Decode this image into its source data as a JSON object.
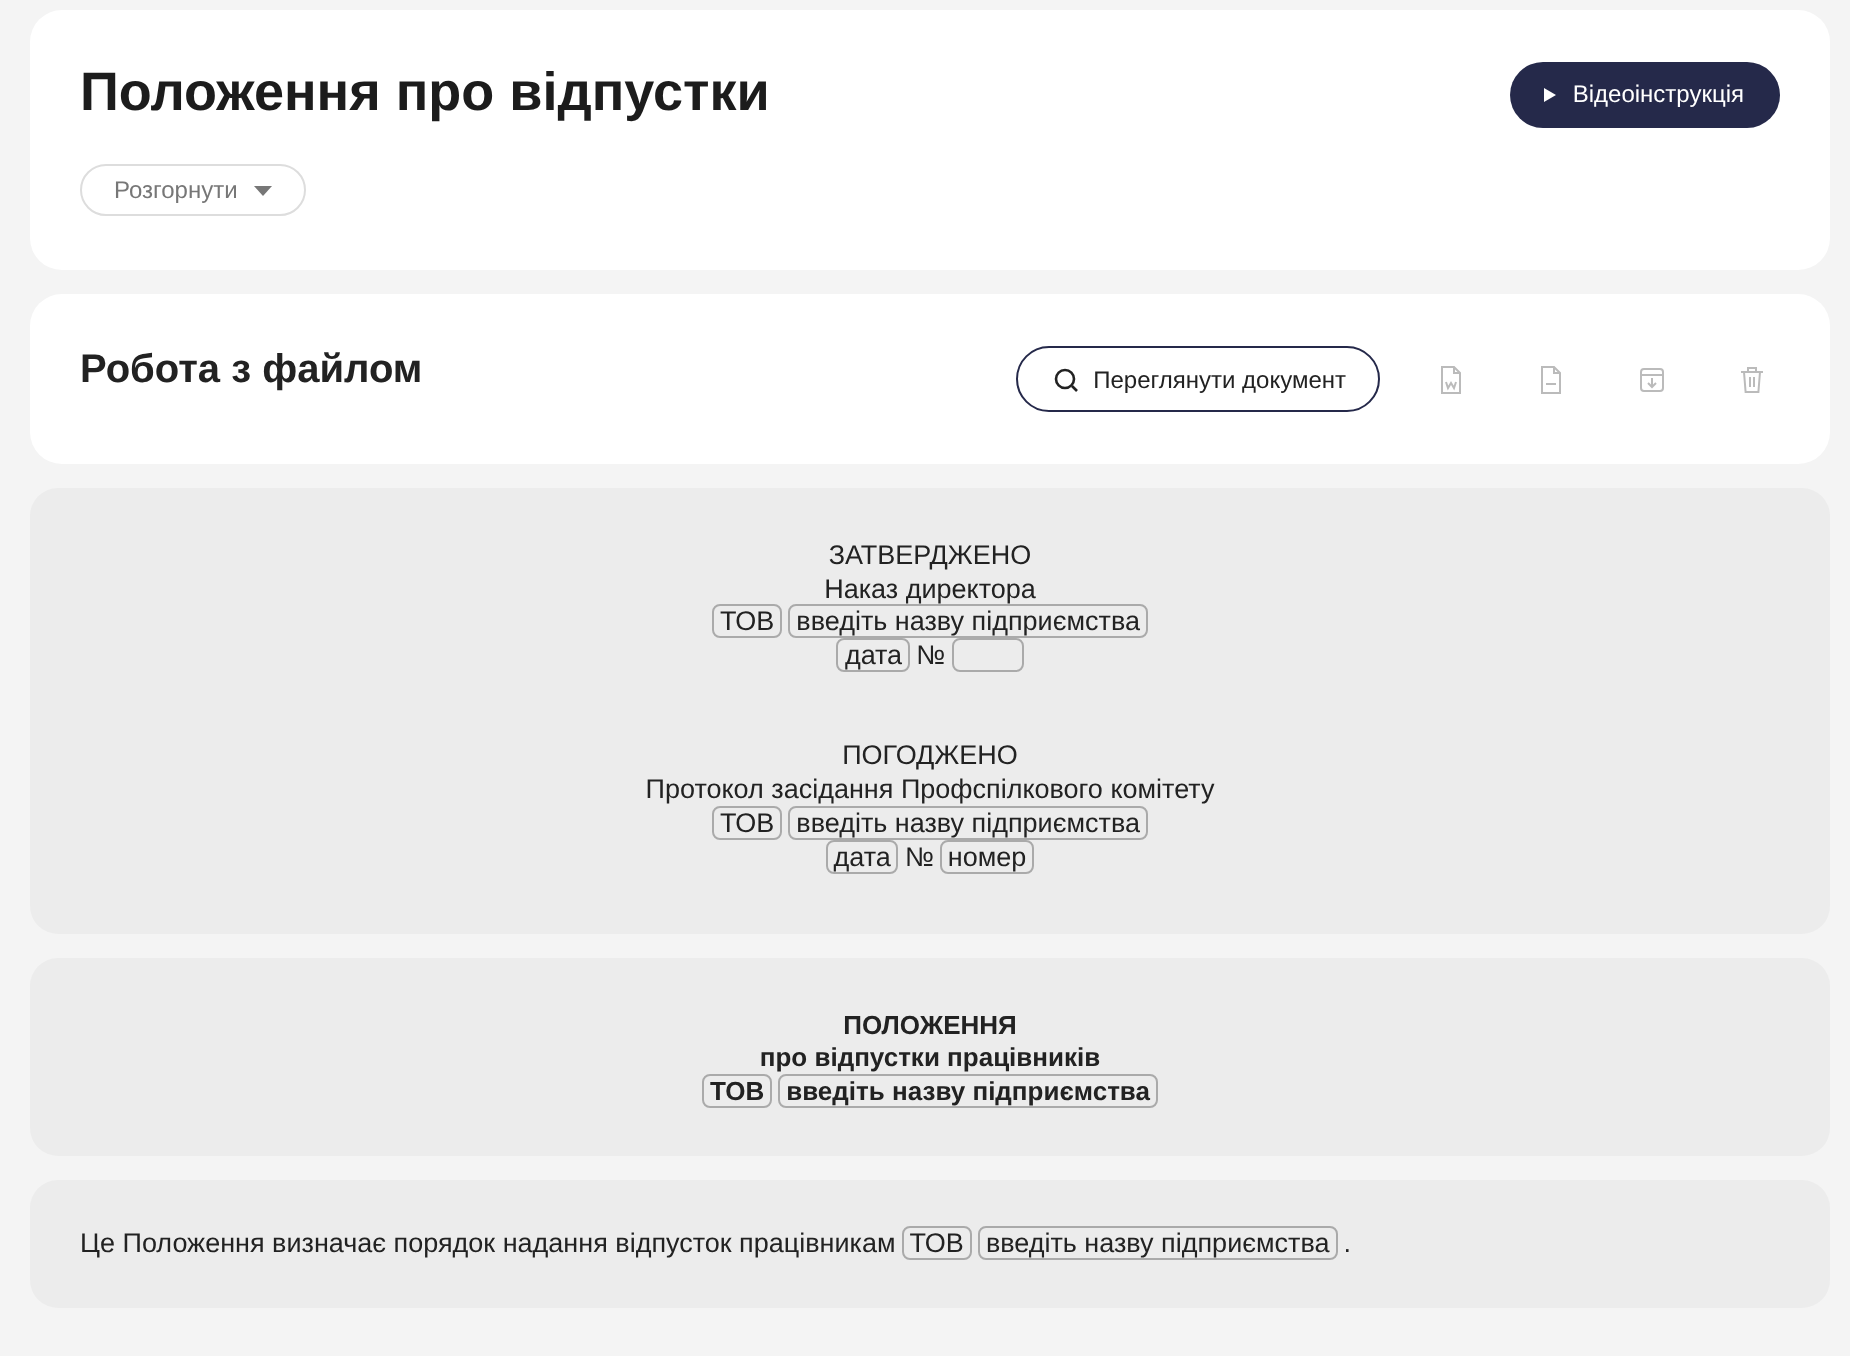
{
  "header": {
    "title": "Положення про відпустки",
    "expand_button": "Розгорнути",
    "video_button": "Відеоінструкція"
  },
  "file_panel": {
    "title": "Робота з файлом",
    "view_button": "Переглянути документ",
    "actions": [
      {
        "kind": "word"
      },
      {
        "kind": "pdf"
      },
      {
        "kind": "download"
      },
      {
        "kind": "delete"
      }
    ]
  },
  "blocks": [
    {
      "kind": "approval",
      "lines": [
        [
          {
            "kind": "text",
            "text": "ЗАТВЕРДЖЕНО"
          }
        ],
        [
          {
            "kind": "text",
            "text": "Наказ директора"
          }
        ],
        [
          {
            "kind": "field",
            "text": "ТОВ"
          },
          {
            "kind": "field",
            "text": "введіть назву підприємства"
          }
        ],
        [
          {
            "kind": "field",
            "text": "дата"
          },
          {
            "kind": "text",
            "text": "№"
          },
          {
            "kind": "field"
          }
        ],
        [
          {
            "kind": "gap"
          }
        ],
        [
          {
            "kind": "text",
            "text": "ПОГОДЖЕНО"
          }
        ],
        [
          {
            "kind": "text",
            "text": "Протокол засідання Профспілкового комітету"
          }
        ],
        [
          {
            "kind": "field",
            "text": "ТОВ"
          },
          {
            "kind": "field",
            "text": "введіть назву підприємства"
          }
        ],
        [
          {
            "kind": "field",
            "text": "дата"
          },
          {
            "kind": "text",
            "text": "№"
          },
          {
            "kind": "field",
            "text": "номер"
          }
        ]
      ]
    },
    {
      "kind": "heading",
      "lines": [
        [
          {
            "kind": "text",
            "text": "ПОЛОЖЕННЯ"
          }
        ],
        [
          {
            "kind": "text",
            "text": "про відпустки працівників"
          }
        ],
        [
          {
            "kind": "field",
            "text": "ТОВ"
          },
          {
            "kind": "field",
            "text": "введіть назву підприємства"
          }
        ]
      ]
    },
    {
      "kind": "paragraph",
      "lines": [
        [
          {
            "kind": "text",
            "text": "Це Положення визначає порядок надання відпусток працівникам"
          },
          {
            "kind": "field",
            "text": "ТОВ"
          },
          {
            "kind": "field",
            "text": "введіть назву підприємства"
          },
          {
            "kind": "text",
            "text": "."
          }
        ]
      ]
    }
  ]
}
